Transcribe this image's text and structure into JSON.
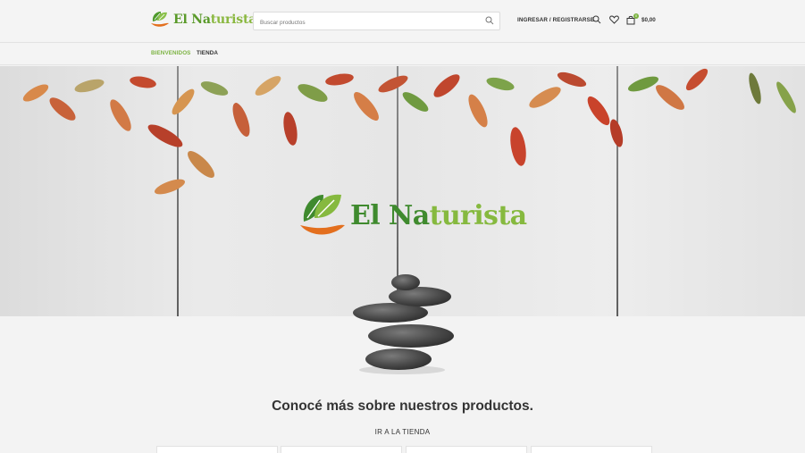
{
  "brand": {
    "name_part1": "El Na",
    "name_part2": "turista",
    "colors": {
      "primary": "#7cb342",
      "dark_green": "#3f8a2e",
      "orange": "#e36f1e"
    }
  },
  "header": {
    "search_placeholder": "Buscar productos",
    "login_label": "INGRESAR / REGISTRARSE",
    "cart_count": "0",
    "cart_total": "$0,00",
    "icons": [
      "search-icon",
      "heart-icon",
      "shopping-bag-icon"
    ]
  },
  "nav": {
    "items": [
      {
        "label": "BIENVENIDOS",
        "active": true
      },
      {
        "label": "TIENDA",
        "active": false
      }
    ]
  },
  "hero": {
    "logo_part1": "El Na",
    "logo_part2": "turista"
  },
  "main": {
    "headline": "Conocé más sobre nuestros productos.",
    "shop_link": "IR A LA TIENDA"
  }
}
